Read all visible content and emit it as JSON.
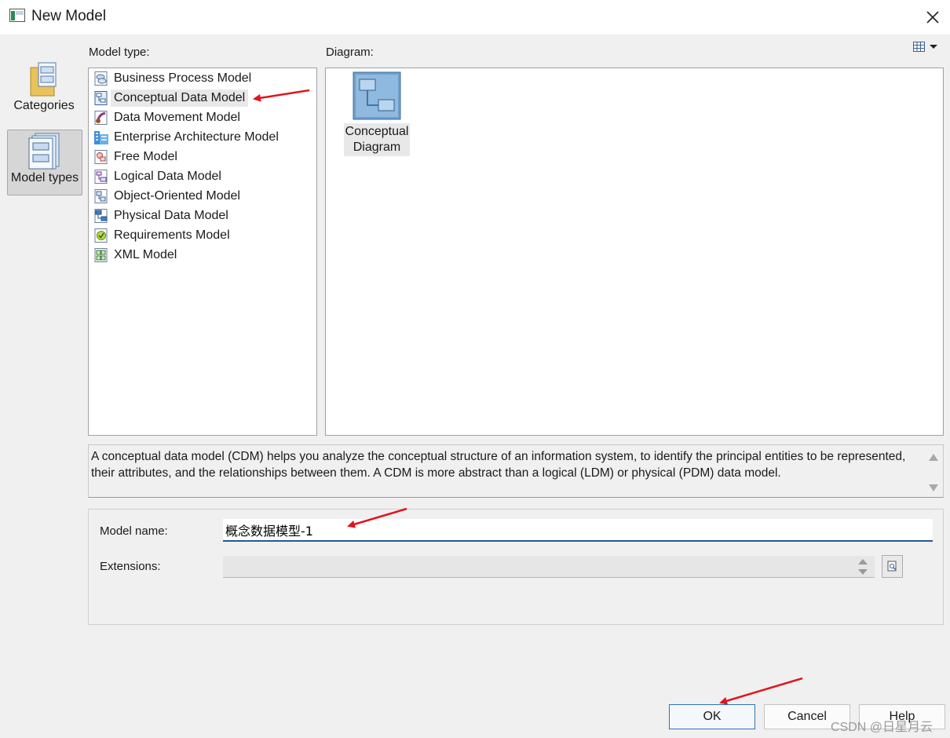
{
  "window": {
    "title": "New Model",
    "close_glyph": "✕"
  },
  "rail": {
    "items": [
      {
        "label": "Categories",
        "icon": "categories-folder-icon"
      },
      {
        "label": "Model types",
        "icon": "model-types-icon",
        "selected": true
      }
    ]
  },
  "model_type": {
    "label": "Model type:",
    "items": [
      {
        "label": "Business Process Model",
        "icon": "business-process-model-icon"
      },
      {
        "label": "Conceptual Data Model",
        "icon": "conceptual-data-model-icon",
        "selected": true
      },
      {
        "label": "Data Movement Model",
        "icon": "data-movement-model-icon"
      },
      {
        "label": "Enterprise Architecture Model",
        "icon": "enterprise-architecture-model-icon"
      },
      {
        "label": "Free Model",
        "icon": "free-model-icon"
      },
      {
        "label": "Logical Data Model",
        "icon": "logical-data-model-icon"
      },
      {
        "label": "Object-Oriented Model",
        "icon": "object-oriented-model-icon"
      },
      {
        "label": "Physical Data Model",
        "icon": "physical-data-model-icon"
      },
      {
        "label": "Requirements Model",
        "icon": "requirements-model-icon"
      },
      {
        "label": "XML Model",
        "icon": "xml-model-icon"
      }
    ]
  },
  "diagram": {
    "label": "Diagram:",
    "items": [
      {
        "label_line1": "Conceptual",
        "label_line2": "Diagram",
        "icon": "conceptual-diagram-icon"
      }
    ]
  },
  "description": "A conceptual data model (CDM) helps you analyze the conceptual structure of an information system, to identify the principal entities to be represented, their attributes, and the relationships between them. A CDM is more abstract than a logical (LDM) or physical (PDM) data model.",
  "form": {
    "model_name_label": "Model name:",
    "model_name_value": "概念数据模型-1",
    "extensions_label": "Extensions:",
    "extensions_value": ""
  },
  "buttons": {
    "ok": "OK",
    "cancel": "Cancel",
    "help": "Help"
  },
  "watermark": "CSDN @日星月云",
  "colors": {
    "annotation_arrow": "#e0141e",
    "ok_border": "#2c72b8",
    "input_underline": "#1f5a94"
  }
}
